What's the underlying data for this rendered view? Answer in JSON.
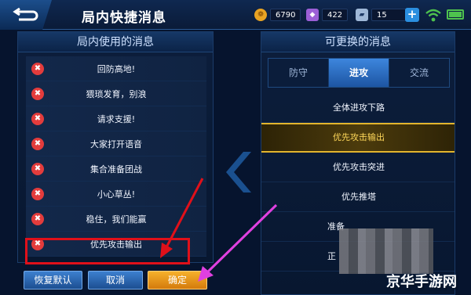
{
  "header": {
    "title": "局内快捷消息"
  },
  "resources": {
    "gold": "6790",
    "diamond": "422",
    "coupon": "15"
  },
  "left_panel": {
    "title": "局内使用的消息",
    "items": [
      "回防高地!",
      "猥琐发育，别浪",
      "请求支援!",
      "大家打开语音",
      "集合准备团战",
      "小心草丛!",
      "稳住，我们能赢",
      "优先攻击输出"
    ]
  },
  "buttons": {
    "reset": "恢复默认",
    "cancel": "取消",
    "confirm": "确定"
  },
  "right_panel": {
    "title": "可更换的消息",
    "tabs": [
      "防守",
      "进攻",
      "交流"
    ],
    "active_tab": "进攻",
    "items": [
      "全体进攻下路",
      "优先攻击输出",
      "优先攻击突进",
      "优先推塔",
      "准备",
      "正"
    ],
    "selected_item": "优先攻击输出"
  },
  "watermark": "京华手游网",
  "colors": {
    "accent": "#e3b52d",
    "remove": "#e33c3c",
    "highlight": "#e0101a",
    "pointer": "#e040e0"
  }
}
